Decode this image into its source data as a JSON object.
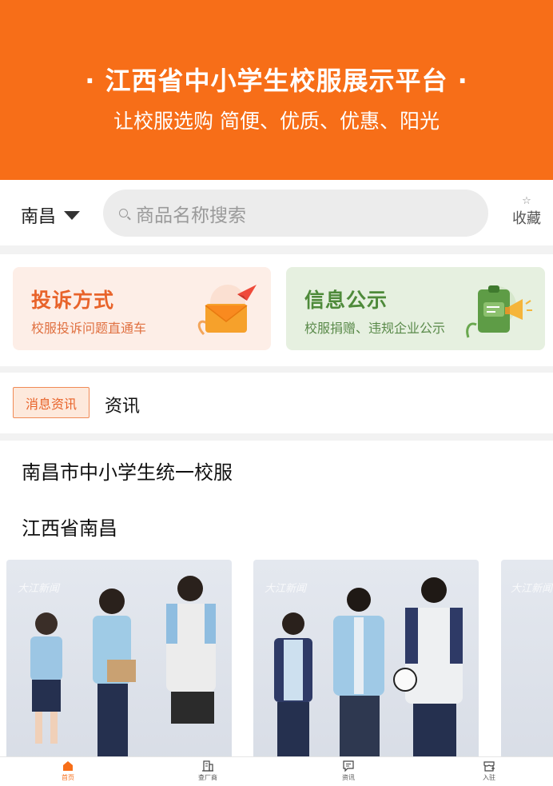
{
  "header": {
    "title": "· 江西省中小学生校服展示平台 ·",
    "subtitle": "让校服选购 简便、优质、优惠、阳光"
  },
  "search": {
    "city": "南昌",
    "placeholder": "商品名称搜索",
    "favorite_label": "收藏"
  },
  "cards": [
    {
      "title": "投诉方式",
      "desc": "校服投诉问题直通车",
      "icon": "envelope-icon"
    },
    {
      "title": "信息公示",
      "desc": "校服捐赠、违规企业公示",
      "icon": "clipboard-megaphone-icon"
    }
  ],
  "news": {
    "badge": "消息资讯",
    "text": "资讯"
  },
  "listing": {
    "title": "南昌市中小学生统一校服",
    "location": "江西省南昌",
    "photos": [
      {
        "name": "summer-uniform-photo",
        "watermark": "大江新闻"
      },
      {
        "name": "winter-uniform-photo",
        "watermark": "大江新闻"
      },
      {
        "name": "third-uniform-photo",
        "watermark": "大江新闻"
      }
    ]
  },
  "tabbar": {
    "items": [
      {
        "label": "首页",
        "icon": "home-icon",
        "active": true
      },
      {
        "label": "查厂商",
        "icon": "building-icon",
        "active": false
      },
      {
        "label": "资讯",
        "icon": "message-icon",
        "active": false
      },
      {
        "label": "入驻",
        "icon": "store-icon",
        "active": false
      }
    ]
  },
  "colors": {
    "brand": "#f76e18",
    "complaint_bg": "#fdeee7",
    "info_bg": "#e6f0e0"
  }
}
